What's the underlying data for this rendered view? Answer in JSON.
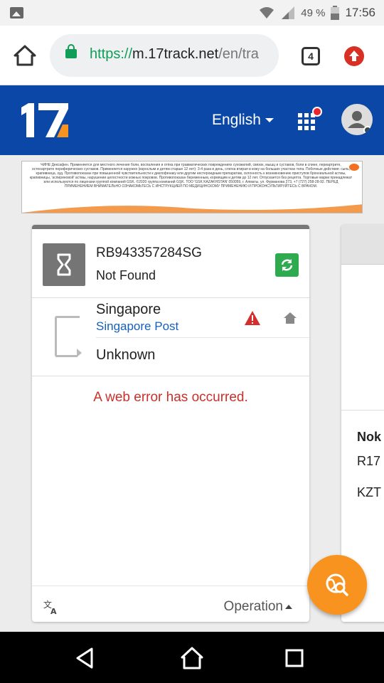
{
  "status_bar": {
    "battery": "49 %",
    "time": "17:56"
  },
  "browser": {
    "url_scheme": "https://",
    "url_host": "m.17track.net",
    "url_path": "/en/tra",
    "tab_count": "4"
  },
  "header": {
    "logo": "17",
    "language": "English"
  },
  "ad": {
    "text": "ЧИНЕ Дексафен. Применяется для местного лечения боли, воспаления и отёка при травматических повреждениях сухожилий, связок, мышц и суставов, боли в спине, периартрите, остеоартрите периферических суставов. Применяется наружно (взрослым и детям старше 12 лет): 3-4 раза в день, слегка втирая в кожу на больших участках тела. Побочные действия: сыпь, крапивница, зуд. Противопоказан при повышенной чувствительности к диклофенаку или другим нестероидным препаратам, склонность к возникновению приступов бронхиальной астмы, крапивницы, 'аспириновой' астмы, нарушении целостности кожных покровов. Противопоказан беременным, кормящим и детям до 12 лет. Отпускается без рецепта. Торговые марки принадлежат или используются по лицензии группой компаний GSK. ©2020 группа компаний GSK. ТОО 'GSK KAZAKHSTAN' 050059, г. Алматы, ул. Фурманова 273, +7 (727) 258-28-92. ПЕРЕД ПРИМЕНЕНИЕМ ВНИМАТЕЛЬНО ОЗНАКОМЬТЕСЬ С ИНСТРУКЦИЕЙ ПО МЕДИЦИНСКОМУ ПРИМЕНЕНИЮ И ПРОКОНСУЛЬТИРУЙТЕСЬ С ВРАЧОМ."
  },
  "card": {
    "tracking_number": "RB943357284SG",
    "status": "Not Found",
    "origin_country": "Singapore",
    "carrier": "Singapore Post",
    "destination": "Unknown",
    "error_message": "A web error has occurred.",
    "operation_label": "Operation"
  },
  "card2": {
    "line1": "Nok",
    "line2": "R17",
    "line3": "KZT"
  },
  "colors": {
    "header_blue": "#0a47a6",
    "fab_orange": "#f7931e",
    "error_red": "#c9302c",
    "carrier_blue": "#1560bd",
    "refresh_green": "#2eaa4f"
  },
  "icons": {
    "status_left": "image-icon",
    "wifi": "wifi-icon",
    "signal": "signal-icon",
    "battery": "battery-icon",
    "home": "home-icon",
    "lock": "lock-icon",
    "tabs": "tabs-icon",
    "update": "update-arrow-icon",
    "apps": "apps-grid-icon",
    "avatar": "user-avatar-icon",
    "hourglass": "hourglass-icon",
    "refresh": "refresh-icon",
    "warning": "warning-icon",
    "destination_home": "home-icon",
    "translate": "translate-icon",
    "fab": "globe-search-icon",
    "back": "back-triangle-icon",
    "home_nav": "home-outline-icon",
    "recents": "recents-square-icon"
  }
}
